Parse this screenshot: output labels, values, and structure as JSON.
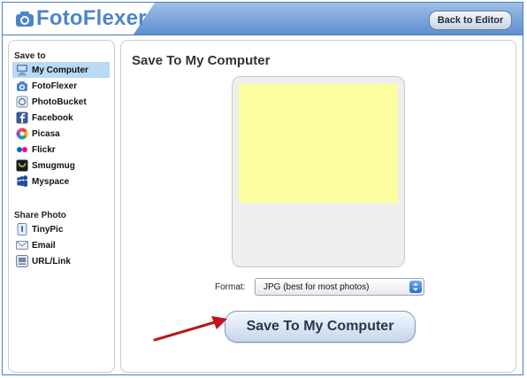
{
  "header": {
    "logo_text": "FotoFlexer",
    "back_label": "Back to Editor"
  },
  "sidebar": {
    "save_to_title": "Save to",
    "save_items": [
      {
        "label": "My Computer",
        "icon": "computer-icon",
        "active": true
      },
      {
        "label": "FotoFlexer",
        "icon": "camera-icon"
      },
      {
        "label": "PhotoBucket",
        "icon": "photobucket-icon"
      },
      {
        "label": "Facebook",
        "icon": "facebook-icon"
      },
      {
        "label": "Picasa",
        "icon": "picasa-icon"
      },
      {
        "label": "Flickr",
        "icon": "flickr-icon"
      },
      {
        "label": "Smugmug",
        "icon": "smugmug-icon"
      },
      {
        "label": "Myspace",
        "icon": "myspace-icon"
      }
    ],
    "share_title": "Share Photo",
    "share_items": [
      {
        "label": "TinyPic",
        "icon": "tinypic-icon"
      },
      {
        "label": "Email",
        "icon": "email-icon"
      },
      {
        "label": "URL/Link",
        "icon": "link-icon"
      }
    ]
  },
  "main": {
    "title": "Save To My Computer",
    "format_label": "Format:",
    "format_value": "JPG (best for most photos)",
    "save_button": "Save To My Computer"
  },
  "colors": {
    "header_blue": "#5e8fcf",
    "active_item": "#b9daf4",
    "preview_yellow": "#fcfd9f",
    "arrow_red": "#c0151b"
  }
}
